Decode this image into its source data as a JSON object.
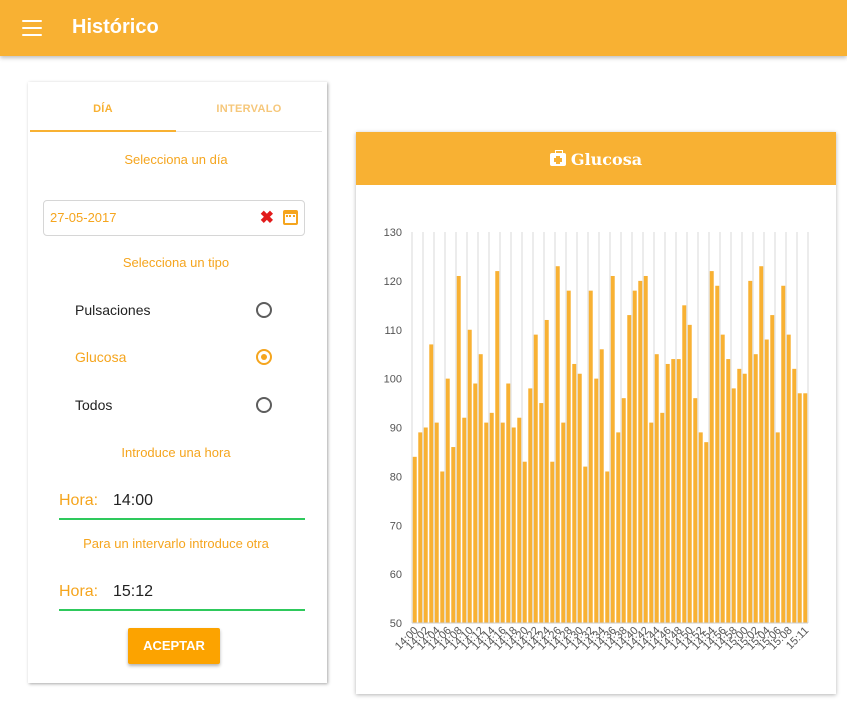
{
  "app": {
    "title": "Histórico"
  },
  "tabs": [
    {
      "label": "DÍA",
      "active": true
    },
    {
      "label": "INTERVALO",
      "active": false
    }
  ],
  "form": {
    "select_day_label": "Selecciona un día",
    "date_value": "27-05-2017",
    "select_type_label": "Selecciona un tipo",
    "types": [
      {
        "label": "Pulsaciones",
        "selected": false
      },
      {
        "label": "Glucosa",
        "selected": true
      },
      {
        "label": "Todos",
        "selected": false
      }
    ],
    "hour_label": "Introduce una hora",
    "hour_prefix": "Hora:",
    "hour_start": "14:00",
    "interval_label": "Para un intervarlo introduce otra",
    "hour_end": "15:12",
    "accept_button": "ACEPTAR"
  },
  "chart": {
    "title": "Glucosa",
    "icon": "medkit-icon"
  },
  "colors": {
    "primary": "#f8b133",
    "accent_text": "#f5a51e",
    "button": "#fca300",
    "clear_icon": "#e21b1b",
    "underline": "#2ec95c",
    "bar": "#f8b133"
  },
  "chart_data": {
    "type": "bar",
    "title": "Glucosa",
    "ylim": [
      50,
      130
    ],
    "yticks": [
      50,
      60,
      70,
      80,
      90,
      100,
      110,
      120,
      130
    ],
    "grid": "vertical",
    "x": [
      "14:00",
      "14:01",
      "14:02",
      "14:03",
      "14:04",
      "14:05",
      "14:06",
      "14:07",
      "14:08",
      "14:09",
      "14:10",
      "14:11",
      "14:12",
      "14:13",
      "14:14",
      "14:15",
      "14:16",
      "14:17",
      "14:18",
      "14:19",
      "14:20",
      "14:21",
      "14:22",
      "14:23",
      "14:24",
      "14:25",
      "14:26",
      "14:27",
      "14:28",
      "14:29",
      "14:30",
      "14:31",
      "14:32",
      "14:33",
      "14:34",
      "14:35",
      "14:36",
      "14:37",
      "14:38",
      "14:39",
      "14:40",
      "14:41",
      "14:42",
      "14:43",
      "14:44",
      "14:45",
      "14:46",
      "14:47",
      "14:48",
      "14:49",
      "14:50",
      "14:51",
      "14:52",
      "14:53",
      "14:54",
      "14:55",
      "14:56",
      "14:57",
      "14:58",
      "14:59",
      "15:00",
      "15:01",
      "15:02",
      "15:03",
      "15:04",
      "15:05",
      "15:06",
      "15:07",
      "15:08",
      "15:09",
      "15:10",
      "15:11"
    ],
    "values": [
      84,
      89,
      90,
      107,
      91,
      81,
      100,
      86,
      121,
      92,
      110,
      99,
      105,
      91,
      93,
      122,
      91,
      99,
      90,
      92,
      83,
      98,
      109,
      95,
      112,
      83,
      123,
      91,
      118,
      103,
      101,
      82,
      118,
      100,
      106,
      81,
      121,
      89,
      96,
      113,
      118,
      120,
      121,
      91,
      105,
      93,
      103,
      104,
      104,
      115,
      111,
      96,
      89,
      87,
      122,
      119,
      109,
      104,
      98,
      102,
      101,
      120,
      105,
      123,
      108,
      113,
      89,
      119,
      109,
      102,
      97,
      97
    ],
    "tick_labels": [
      "14:00",
      "14:02",
      "14:04",
      "14:06",
      "14:08",
      "14:10",
      "14:12",
      "14:14",
      "14:16",
      "14:18",
      "14:20",
      "14:22",
      "14:24",
      "14:26",
      "14:28",
      "14:30",
      "14:32",
      "14:34",
      "14:36",
      "14:38",
      "14:40",
      "14:42",
      "14:44",
      "14:46",
      "14:48",
      "14:50",
      "14:52",
      "14:54",
      "14:56",
      "14:58",
      "15:00",
      "15:02",
      "15:04",
      "15:06",
      "15:08",
      "15:11"
    ]
  }
}
